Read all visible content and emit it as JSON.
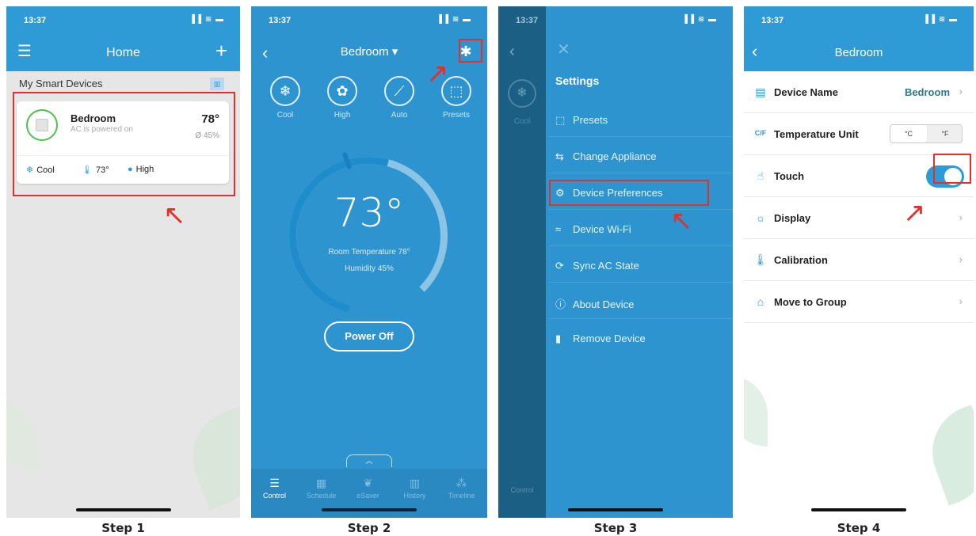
{
  "colors": {
    "accent": "#2f9bd6",
    "highlight": "#e0322d",
    "power_on": "#4fc04f"
  },
  "steps": [
    "Step 1",
    "Step 2",
    "Step 3",
    "Step 4"
  ],
  "status": {
    "time": "13:37",
    "signal": "▐▐ ≋ ▬"
  },
  "screen1": {
    "title": "Home",
    "section_title": "My Smart Devices",
    "device": {
      "name": "Bedroom",
      "status": "AC is powered on",
      "temperature": "78°",
      "humidity": "Ø 45%",
      "mode": "Cool",
      "setpoint": "73°",
      "fan": "High"
    }
  },
  "screen2": {
    "room": "Bedroom ▾",
    "modes": [
      {
        "label": "Cool",
        "icon": "snowflake-icon",
        "glyph": "❄"
      },
      {
        "label": "High",
        "icon": "fan-icon",
        "glyph": "✿"
      },
      {
        "label": "Auto",
        "icon": "swing-icon",
        "glyph": "⟋"
      },
      {
        "label": "Presets",
        "icon": "presets-icon",
        "glyph": "⬚"
      }
    ],
    "setpoint": "73°",
    "room_temperature": "Room Temperature 78°",
    "humidity": "Humidity 45%",
    "power_button": "Power Off",
    "tabs": [
      "Control",
      "Schedule",
      "eSaver",
      "History",
      "Timeline"
    ]
  },
  "screen3": {
    "title": "Settings",
    "dim_mode_label": "Cool",
    "dim_tab_label": "Control",
    "menu": [
      {
        "label": "Presets",
        "icon": "presets-icon",
        "glyph": "⬚"
      },
      {
        "label": "Change Appliance",
        "icon": "swap-icon",
        "glyph": "⇆"
      },
      {
        "label": "Device Preferences",
        "icon": "gears-icon",
        "glyph": "⚙"
      },
      {
        "label": "Device Wi-Fi",
        "icon": "wifi-icon",
        "glyph": "≈"
      },
      {
        "label": "Sync AC State",
        "icon": "sync-icon",
        "glyph": "⟳"
      },
      {
        "label": "About Device",
        "icon": "info-icon",
        "glyph": "ⓘ"
      },
      {
        "label": "Remove Device",
        "icon": "trash-icon",
        "glyph": "▮"
      }
    ]
  },
  "screen4": {
    "title": "Bedroom",
    "rows": {
      "device_name": {
        "label": "Device Name",
        "value": "Bedroom"
      },
      "temperature_unit": {
        "label": "Temperature Unit",
        "icon_text": "C/F",
        "options": [
          "°C",
          "°F"
        ],
        "selected": "°C"
      },
      "touch": {
        "label": "Touch",
        "enabled": true
      },
      "display": {
        "label": "Display"
      },
      "calibration": {
        "label": "Calibration"
      },
      "move_to_group": {
        "label": "Move to Group"
      }
    }
  }
}
